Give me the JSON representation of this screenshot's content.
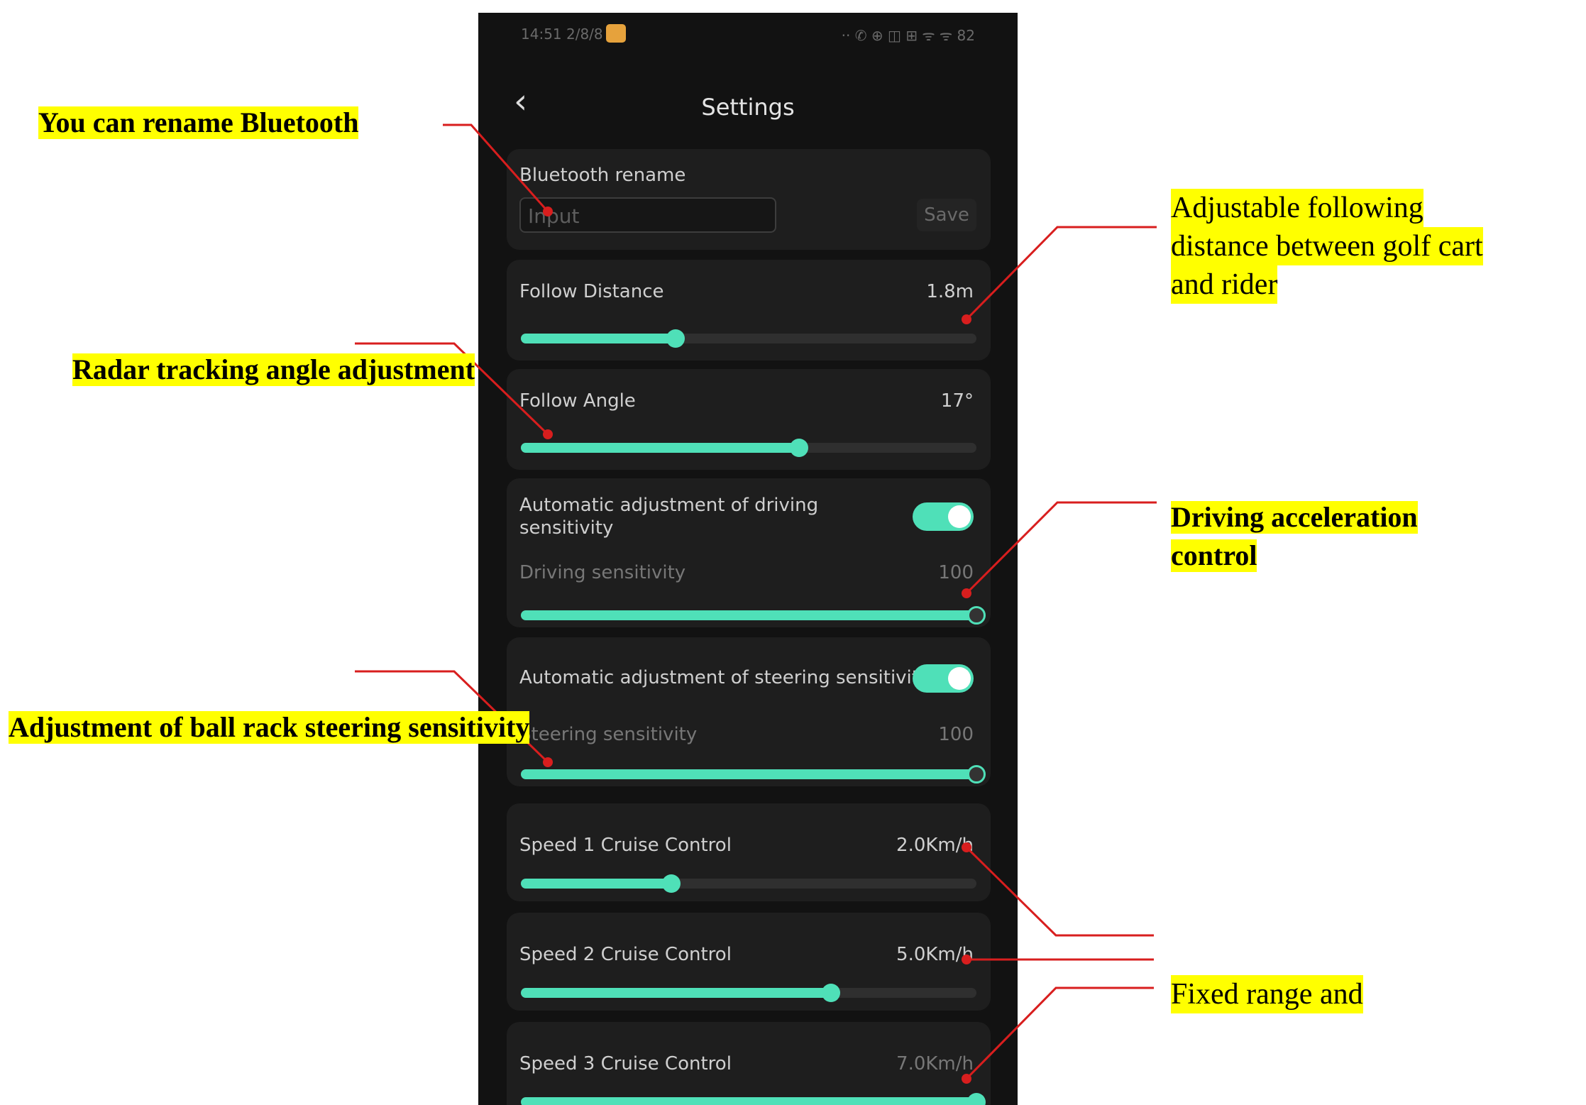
{
  "status_bar": {
    "time": "14:51 2/8/8",
    "icons": "·· ✆ ⊕ ◫ ⊞ ᯤ ᯤ 82"
  },
  "header": {
    "back_icon": "chevron-left-icon",
    "back_glyph": "‹",
    "title": "Settings"
  },
  "bluetooth": {
    "label": "Bluetooth rename",
    "placeholder": "Input",
    "save_label": "Save"
  },
  "follow_distance": {
    "label": "Follow Distance",
    "value": "1.8m",
    "level": 0.34
  },
  "follow_angle": {
    "label": "Follow Angle",
    "value": "17°",
    "level": 0.61
  },
  "driving": {
    "auto_label": "Automatic adjustment of driving sensitivity",
    "auto_on": true,
    "label": "Driving sensitivity",
    "value": "100",
    "level": 1.0
  },
  "steering": {
    "auto_label": "Automatic adjustment of steering sensitivity",
    "auto_on": true,
    "label": "Steering sensitivity",
    "value": "100",
    "level": 1.0
  },
  "speed1": {
    "label": "Speed 1 Cruise Control",
    "value": "2.0Km/h",
    "level": 0.33
  },
  "speed2": {
    "label": "Speed 2 Cruise Control",
    "value": "5.0Km/h",
    "level": 0.68
  },
  "speed3": {
    "label": "Speed 3 Cruise Control",
    "value": "7.0Km/h",
    "level": 1.0
  },
  "annotations": {
    "rename": "You can rename Bluetooth",
    "distance_l1": "Adjustable following",
    "distance_l2": "distance between golf cart",
    "distance_l3": "and rider",
    "radar": "Radar tracking angle adjustment",
    "accel_l1": "Driving acceleration",
    "accel_l2": "control",
    "steering": "Adjustment of ball rack steering sensitivity",
    "fixed": "Fixed range and"
  },
  "colors": {
    "accent": "#4fe0b8",
    "background": "#121212",
    "card": "#1e1e1e",
    "highlight": "#ffff00",
    "leader": "#d81e1e"
  }
}
